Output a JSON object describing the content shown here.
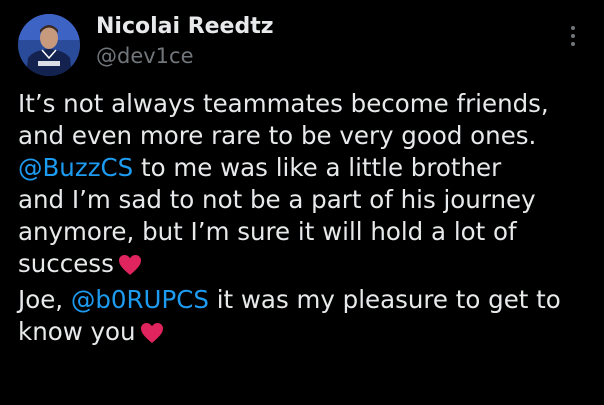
{
  "author": {
    "display_name": "Nicolai Reedtz",
    "handle": "@dev1ce"
  },
  "tweet": {
    "line1": "It’s not always teammates become friends,",
    "line2": "and even more rare to be very good ones.",
    "line3_mention": "@BuzzCS",
    "line3_text": " to me was like a little brother",
    "line4": "and I’m sad to not be a part of his journey",
    "line5": "anymore, but I’m sure it will hold a lot of",
    "line6": "success",
    "line7_prefix": "Joe, ",
    "line7_mention": "@b0RUPCS",
    "line7_text": " it was my pleasure to get to",
    "line8": "know you"
  },
  "icons": {
    "more": "more-vertical-icon",
    "heart": "red-heart-emoji"
  },
  "colors": {
    "background": "#000000",
    "text": "#e7e9ea",
    "secondary": "#71767b",
    "mention": "#1d9bf0",
    "heart": "#e0245e"
  }
}
